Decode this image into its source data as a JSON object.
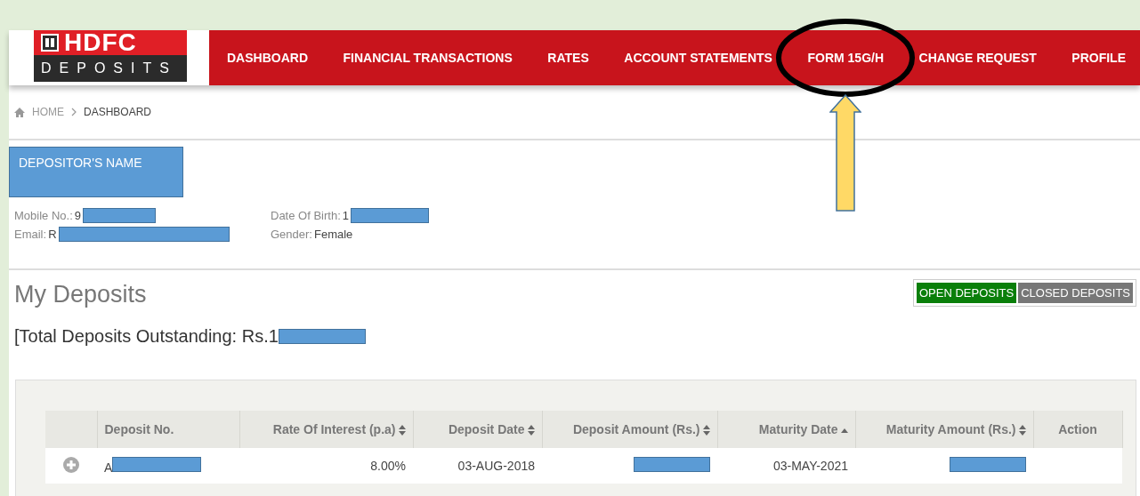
{
  "logo": {
    "brand": "HDFC",
    "sub": "DEPOSITS"
  },
  "nav": [
    {
      "label": "DASHBOARD",
      "circled": false
    },
    {
      "label": "FINANCIAL TRANSACTIONS",
      "circled": false
    },
    {
      "label": "RATES",
      "circled": false
    },
    {
      "label": "ACCOUNT STATEMENTS",
      "circled": false
    },
    {
      "label": "FORM 15G/H",
      "circled": true
    },
    {
      "label": "CHANGE REQUEST",
      "circled": false
    },
    {
      "label": "PROFILE",
      "circled": false
    }
  ],
  "breadcrumb": [
    "HOME",
    "DASHBOARD"
  ],
  "depositor": {
    "name": "DEPOSITOR'S NAME"
  },
  "info": [
    {
      "label": "Mobile No.:",
      "value": "9",
      "redacted": true
    },
    {
      "label": "Date Of Birth:",
      "value": "1",
      "redacted": true
    },
    {
      "label": "Email:",
      "value": "R",
      "redacted": true
    },
    {
      "label": "Gender:",
      "value": "Female",
      "redacted": false
    }
  ],
  "title": "My Deposits",
  "toggle": [
    {
      "label": "OPEN DEPOSITS",
      "selected": true
    },
    {
      "label": "CLOSED DEPOSITS",
      "selected": false
    }
  ],
  "total": {
    "label": "[Total Deposits Outstanding: Rs.1",
    "redacted": true
  },
  "table": {
    "columns": [
      {
        "kind": "plain"
      },
      {
        "label": "Deposit No.",
        "kind": "plain"
      },
      {
        "label": "Rate Of Interest (p.a)",
        "kind": "sortable"
      },
      {
        "label": "Deposit Date",
        "kind": "sortable"
      },
      {
        "label": "Deposit Amount (Rs.)",
        "kind": "sortable"
      },
      {
        "label": "Maturity Date",
        "kind": "sorted"
      },
      {
        "label": "Maturity Amount (Rs.)",
        "kind": "sortable"
      },
      {
        "label": "Action",
        "kind": "plain"
      }
    ],
    "rows": [
      [
        {
          "kind": "expand"
        },
        {
          "kind": "text",
          "text": "A",
          "redacted": true
        },
        {
          "kind": "text",
          "text": "8.00%",
          "redacted": false
        },
        {
          "kind": "text",
          "text": "03-AUG-2018",
          "redacted": false
        },
        {
          "kind": "text",
          "redacted": true
        },
        {
          "kind": "text",
          "text": "03-MAY-2021",
          "redacted": false
        },
        {
          "kind": "text",
          "redacted": true
        },
        {
          "kind": "empty"
        }
      ]
    ]
  }
}
